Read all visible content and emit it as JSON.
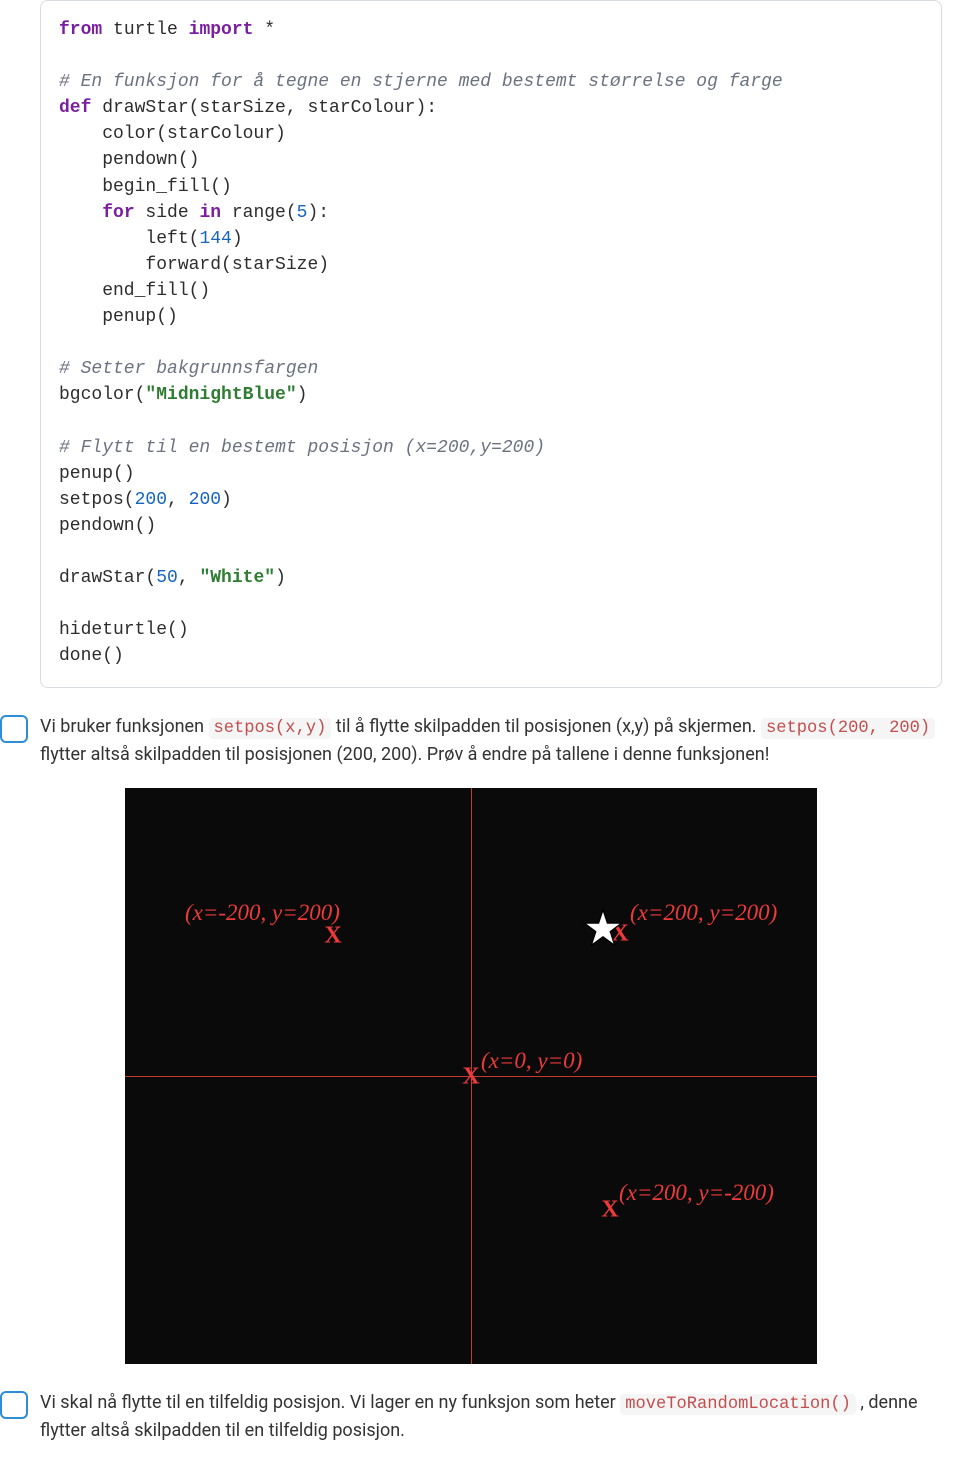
{
  "code": {
    "l1a": "from",
    "l1b": " turtle ",
    "l1c": "import",
    "l1d": " *",
    "l3": "# En funksjon for å tegne en stjerne med bestemt størrelse og farge",
    "l4a": "def",
    "l4b": " drawStar(starSize, starColour):",
    "l5": "    color(starColour)",
    "l6": "    pendown()",
    "l7": "    begin_fill()",
    "l8a": "    ",
    "l8b": "for",
    "l8c": " side ",
    "l8d": "in",
    "l8e": " range(",
    "l8f": "5",
    "l8g": "):",
    "l9a": "        left(",
    "l9b": "144",
    "l9c": ")",
    "l10": "        forward(starSize)",
    "l11": "    end_fill()",
    "l12": "    penup()",
    "l14": "# Setter bakgrunnsfargen",
    "l15a": "bgcolor(",
    "l15b": "\"MidnightBlue\"",
    "l15c": ")",
    "l17": "# Flytt til en bestemt posisjon (x=200,y=200)",
    "l18": "penup()",
    "l19a": "setpos(",
    "l19b": "200",
    "l19c": ", ",
    "l19d": "200",
    "l19e": ")",
    "l20": "pendown()",
    "l22a": "drawStar(",
    "l22b": "50",
    "l22c": ", ",
    "l22d": "\"White\"",
    "l22e": ")",
    "l24": "hideturtle()",
    "l25": "done()"
  },
  "para1": {
    "t1": "Vi bruker funksjonen ",
    "c1": "setpos(x,y)",
    "t2": " til å flytte skilpadden til posisjonen (x,y) på skjermen. ",
    "c2": "setpos(200, 200)",
    "t3": " flytter altså skilpadden til posisjonen (200, 200). Prøv å endre på tallene i denne funksjonen!"
  },
  "diagram": {
    "tl": "(x=-200, y=200)",
    "tr": "(x=200, y=200)",
    "ct": "(x=0, y=0)",
    "br": "(x=200, y=-200)"
  },
  "para2": {
    "t1": "Vi skal nå flytte til en tilfeldig posisjon. Vi lager en ny funksjon som heter ",
    "c1": "moveToRandomLocation()",
    "t2": " , denne flytter altså skilpadden til en tilfeldig posisjon."
  }
}
